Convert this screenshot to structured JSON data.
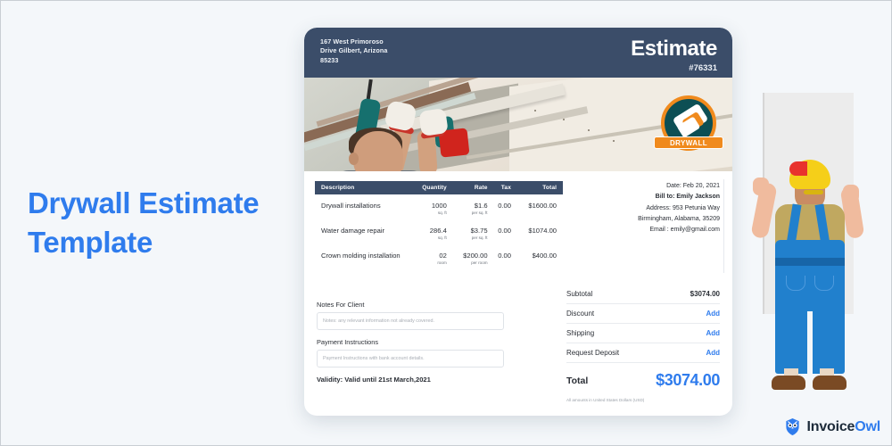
{
  "headline": "Drywall Estimate Template",
  "document": {
    "company_address": "167 West Primoroso\nDrive Gilbert, Arizona\n85233",
    "title": "Estimate",
    "number": "#76331",
    "badge": {
      "text": "DRYWALL"
    },
    "table": {
      "columns": [
        "Description",
        "Quantity",
        "Rate",
        "Tax",
        "Total"
      ],
      "rows": [
        {
          "description": "Drywall installations",
          "quantity": "1000",
          "quantity_unit": "sq. ft",
          "rate": "$1.6",
          "rate_unit": "per sq. ft",
          "tax": "0.00",
          "total": "$1600.00"
        },
        {
          "description": "Water damage repair",
          "quantity": "286.4",
          "quantity_unit": "sq. ft",
          "rate": "$3.75",
          "rate_unit": "per sq. ft",
          "tax": "0.00",
          "total": "$1074.00"
        },
        {
          "description": "Crown molding installation",
          "quantity": "02",
          "quantity_unit": "room",
          "rate": "$200.00",
          "rate_unit": "per room",
          "tax": "0.00",
          "total": "$400.00"
        }
      ]
    },
    "bill_to": {
      "date": "Date: Feb 20, 2021",
      "name": "Bill to: Emily Jackson",
      "address_line1": "Address: 953 Petunia Way",
      "address_line2": "Birmingham,  Alabama, 35209",
      "email": "Email : emily@gmail.com"
    },
    "totals": {
      "subtotal_label": "Subtotal",
      "subtotal_value": "$3074.00",
      "discount_label": "Discount",
      "discount_value": "Add",
      "shipping_label": "Shipping",
      "shipping_value": "Add",
      "deposit_label": "Request Deposit",
      "deposit_value": "Add",
      "total_label": "Total",
      "total_value": "$3074.00",
      "currency_note": "All amounts in United States Dollars (USD)"
    },
    "notes": {
      "notes_label": "Notes For Client",
      "notes_placeholder": "Notes: any relevant information not already covered.",
      "payment_label": "Payment Instructions",
      "payment_placeholder": "Payment Instructions with bank account details.",
      "validity": "Validity: Valid until 21st March,2021"
    }
  },
  "footer": {
    "brand_first": "Invoice",
    "brand_second": "Owl"
  },
  "colors": {
    "page_bg": "#f4f7fa",
    "accent_blue": "#2f7ced",
    "header_navy": "#3b4d69",
    "badge_orange": "#f08a1d",
    "badge_teal": "#0d4f54"
  }
}
